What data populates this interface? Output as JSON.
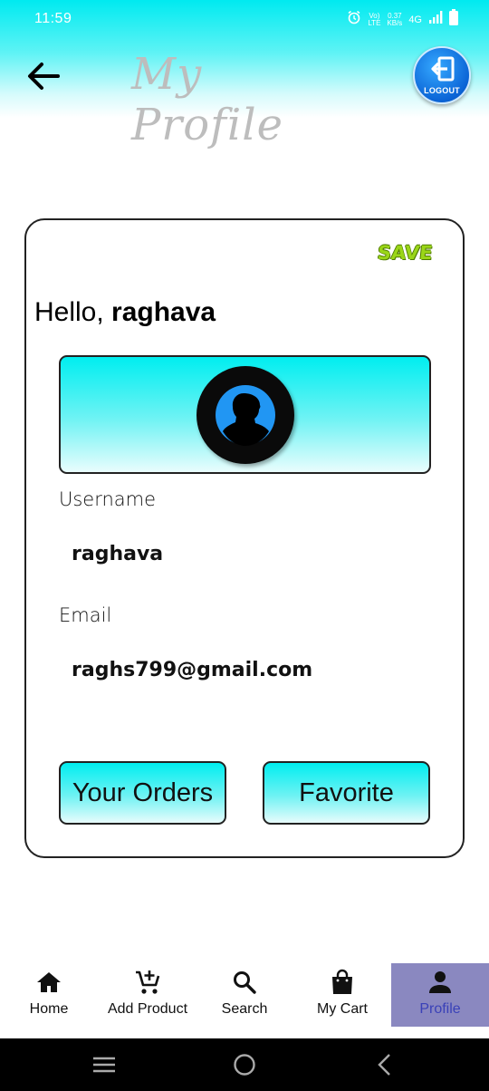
{
  "status_bar": {
    "time": "11:59",
    "lte_top": "Vo)",
    "lte_bottom": "LTE",
    "speed_top": "0.37",
    "speed_bottom": "KB/s",
    "network": "4G"
  },
  "header": {
    "title": "My Profile",
    "logout_label": "LOGOUT",
    "back_icon": "arrow-left-icon",
    "logout_icon": "exit-door-icon",
    "gradient_color": "#00eaf0"
  },
  "profile": {
    "save_label": "SAVE",
    "greeting_prefix": "Hello,",
    "greeting_name": "raghava",
    "avatar_icon": "user-silhouette-icon",
    "username_label": "Username",
    "username_value": "raghava",
    "email_label": "Email",
    "email_value": "raghs799@gmail.com",
    "orders_label": "Your Orders",
    "favorite_label": "Favorite"
  },
  "bottom_nav": {
    "active_color": "#8a88c0",
    "items": [
      {
        "label": "Home",
        "icon": "home-icon"
      },
      {
        "label": "Add Product",
        "icon": "cart-add-icon"
      },
      {
        "label": "Search",
        "icon": "search-icon"
      },
      {
        "label": "My Cart",
        "icon": "shopping-bag-icon"
      },
      {
        "label": "Profile",
        "icon": "person-icon",
        "active": true
      }
    ]
  }
}
